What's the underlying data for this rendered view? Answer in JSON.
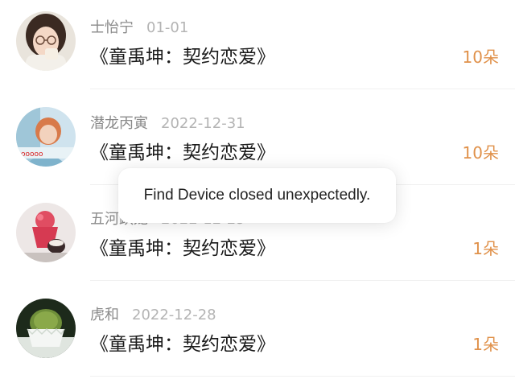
{
  "rows": [
    {
      "name": "士怡宁",
      "date": "01-01",
      "title": "《童禹坤：契约恋爱》",
      "count": "10朵"
    },
    {
      "name": "潜龙丙寅",
      "date": "2022-12-31",
      "title": "《童禹坤：契约恋爱》",
      "count": "10朵"
    },
    {
      "name": "五河跃龙",
      "date": "2022-12-29",
      "title": "《童禹坤：契约恋爱》",
      "count": "1朵"
    },
    {
      "name": "虎和",
      "date": "2022-12-28",
      "title": "《童禹坤：契约恋爱》",
      "count": "1朵"
    }
  ],
  "toast": {
    "message": "Find Device closed unexpectedly."
  },
  "colors": {
    "accent": "#e0914a",
    "name_gray": "#8a8a8a",
    "date_gray": "#b4b4b4",
    "title_text": "#1a1a1a"
  }
}
